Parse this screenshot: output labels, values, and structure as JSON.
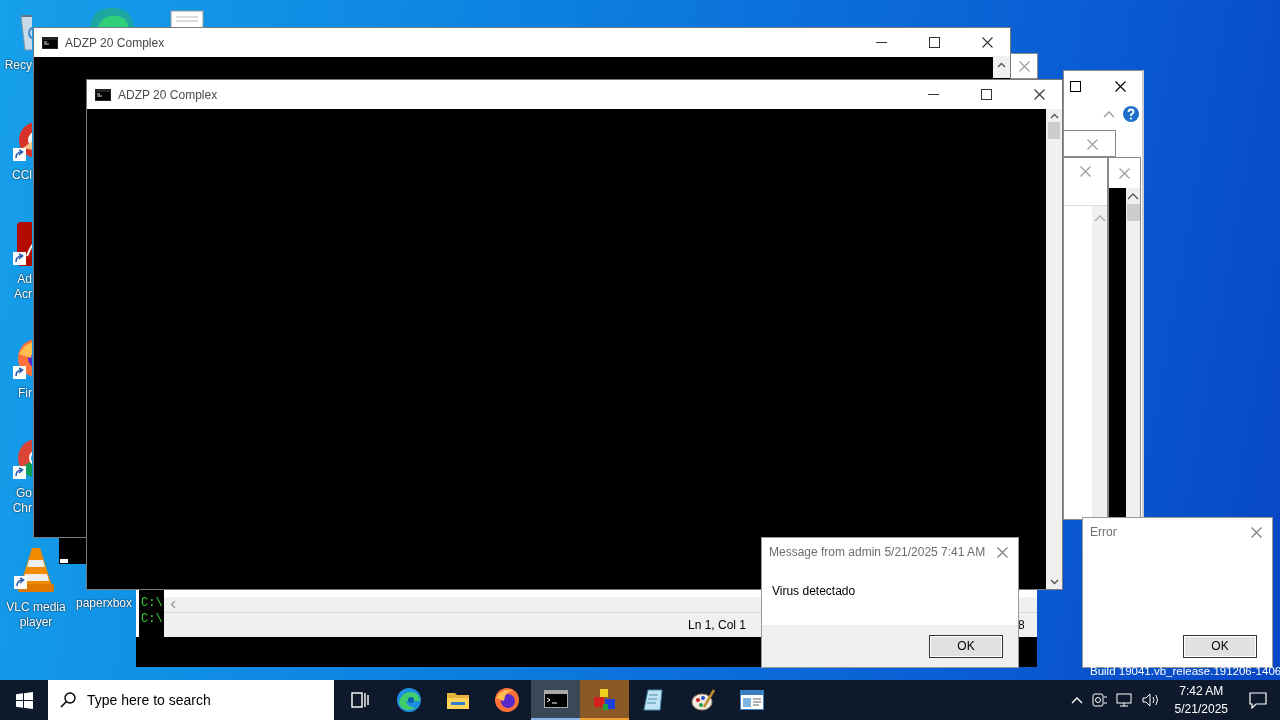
{
  "desktop_icons": [
    {
      "kind": "recycle",
      "lines": [
        "Recy"
      ]
    },
    {
      "kind": "ccleaner",
      "lines": [
        "CCl"
      ]
    },
    {
      "kind": "acrobat",
      "lines": [
        "Ad",
        "Acr"
      ]
    },
    {
      "kind": "firefox",
      "lines": [
        "Fir"
      ]
    },
    {
      "kind": "chrome",
      "lines": [
        "Go",
        "Chr"
      ]
    },
    {
      "kind": "vlc",
      "lines": [
        "VLC media",
        "player"
      ]
    },
    {
      "kind": "blank",
      "lines": [
        "paperxbox"
      ]
    }
  ],
  "windows": [
    {
      "title": "ADZP 20 Complex"
    },
    {
      "title": "ADZP 20 Complex"
    }
  ],
  "editor": {
    "console_lines": [
      "C:\\",
      "C:\\"
    ],
    "status": [
      "Ln 1, Col 1",
      "8"
    ]
  },
  "message_box": {
    "title": "Message from admin 5/21/2025 7:41 AM",
    "text": "Virus detectado",
    "button": "OK"
  },
  "error_box": {
    "title": "Error",
    "button": "OK"
  },
  "build_label": "Build 19041.vb_release.191206-1406",
  "taskbar": {
    "search_placeholder": "Type here to search",
    "apps": [
      {
        "kind": "task-view",
        "active": false,
        "flashing": false
      },
      {
        "kind": "edge",
        "active": false,
        "flashing": false
      },
      {
        "kind": "folder",
        "active": false,
        "flashing": false
      },
      {
        "kind": "firefox",
        "active": false,
        "flashing": false
      },
      {
        "kind": "console",
        "active": true,
        "flashing": false
      },
      {
        "kind": "cubes",
        "active": false,
        "flashing": true
      },
      {
        "kind": "notepad",
        "active": false,
        "flashing": false
      },
      {
        "kind": "paint",
        "active": false,
        "flashing": false
      },
      {
        "kind": "window",
        "active": false,
        "flashing": false
      }
    ],
    "time": "7:42 AM",
    "date": "5/21/2025"
  }
}
